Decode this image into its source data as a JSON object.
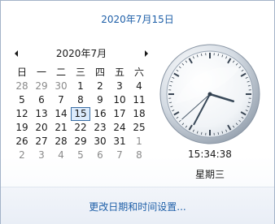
{
  "header": {
    "date_text": "2020年7月15日"
  },
  "calendar": {
    "month_title": "2020年7月",
    "weekday_headers": [
      "日",
      "一",
      "二",
      "三",
      "四",
      "五",
      "六"
    ],
    "weeks": [
      [
        {
          "d": "28",
          "o": true
        },
        {
          "d": "29",
          "o": true
        },
        {
          "d": "30",
          "o": true
        },
        {
          "d": "1"
        },
        {
          "d": "2"
        },
        {
          "d": "3"
        },
        {
          "d": "4"
        }
      ],
      [
        {
          "d": "5"
        },
        {
          "d": "6"
        },
        {
          "d": "7"
        },
        {
          "d": "8"
        },
        {
          "d": "9"
        },
        {
          "d": "10"
        },
        {
          "d": "11"
        }
      ],
      [
        {
          "d": "12"
        },
        {
          "d": "13"
        },
        {
          "d": "14"
        },
        {
          "d": "15",
          "today": true
        },
        {
          "d": "16"
        },
        {
          "d": "17"
        },
        {
          "d": "18"
        }
      ],
      [
        {
          "d": "19"
        },
        {
          "d": "20"
        },
        {
          "d": "21"
        },
        {
          "d": "22"
        },
        {
          "d": "23"
        },
        {
          "d": "24"
        },
        {
          "d": "25"
        }
      ],
      [
        {
          "d": "26"
        },
        {
          "d": "27"
        },
        {
          "d": "28"
        },
        {
          "d": "29"
        },
        {
          "d": "30"
        },
        {
          "d": "31"
        },
        {
          "d": "1",
          "o": true
        }
      ],
      [
        {
          "d": "2",
          "o": true
        },
        {
          "d": "3",
          "o": true
        },
        {
          "d": "4",
          "o": true
        },
        {
          "d": "5",
          "o": true
        },
        {
          "d": "6",
          "o": true
        },
        {
          "d": "7",
          "o": true
        },
        {
          "d": "8",
          "o": true
        }
      ]
    ]
  },
  "clock": {
    "time_text": "15:34:38",
    "weekday": "星期三",
    "hours": 15,
    "minutes": 34,
    "seconds": 38
  },
  "footer": {
    "link_text": "更改日期和时间设置..."
  },
  "colors": {
    "link": "#1e5fa8",
    "today_border": "#3a6ea5",
    "today_fill": "#dcebfc",
    "other_month": "#8a8a8a"
  }
}
